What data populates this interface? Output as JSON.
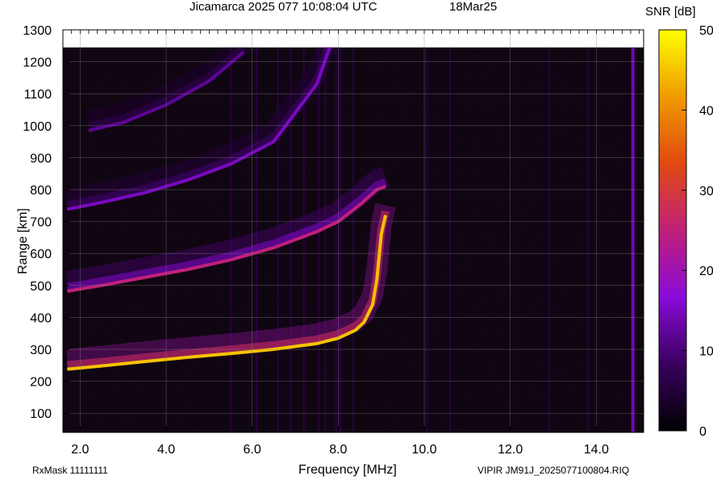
{
  "header": {
    "station_title": "Jicamarca 2025 077 10:08:04 UTC",
    "date_label": "18Mar25",
    "colorbar_title": "SNR [dB]"
  },
  "footer": {
    "rxmask": "RxMask 11111111",
    "file_label": "VIPIR  JM91J_2025077100804.RIQ"
  },
  "chart_data": {
    "type": "heatmap",
    "title": "Jicamarca 2025 077 10:08:04 UTC",
    "xlabel": "Frequency [MHz]",
    "ylabel": "Range [km]",
    "xlim": [
      1.6,
      15.1
    ],
    "ylim": [
      40,
      1300
    ],
    "data_top_range": 1245,
    "x_ticks": [
      "2.0",
      "4.0",
      "6.0",
      "8.0",
      "10.0",
      "12.0",
      "14.0"
    ],
    "x_tick_values": [
      2,
      4,
      6,
      8,
      10,
      12,
      14
    ],
    "y_ticks": [
      "100",
      "200",
      "300",
      "400",
      "500",
      "600",
      "700",
      "800",
      "900",
      "1000",
      "1100",
      "1200",
      "1300"
    ],
    "y_tick_values": [
      100,
      200,
      300,
      400,
      500,
      600,
      700,
      800,
      900,
      1000,
      1100,
      1200,
      1300
    ],
    "grid": true,
    "colorbar": {
      "label": "SNR [dB]",
      "range": [
        0,
        50
      ],
      "ticks": [
        "0",
        "10",
        "20",
        "30",
        "40",
        "50"
      ],
      "tick_values": [
        0,
        10,
        20,
        30,
        40,
        50
      ],
      "colormap": [
        "#000000",
        "#3a0060",
        "#8a0bd8",
        "#c0207a",
        "#e04a10",
        "#f09a00",
        "#ffff00"
      ]
    },
    "traces": [
      {
        "name": "first-hop",
        "points": [
          [
            1.7,
            238
          ],
          [
            2.5,
            248
          ],
          [
            3.5,
            262
          ],
          [
            4.5,
            275
          ],
          [
            5.5,
            287
          ],
          [
            6.5,
            300
          ],
          [
            7.5,
            318
          ],
          [
            8.0,
            335
          ],
          [
            8.4,
            360
          ],
          [
            8.6,
            385
          ],
          [
            8.8,
            440
          ],
          [
            8.9,
            520
          ],
          [
            9.0,
            660
          ],
          [
            9.1,
            720
          ]
        ],
        "peak_snr": 45
      },
      {
        "name": "second-hop",
        "points": [
          [
            1.7,
            482
          ],
          [
            2.5,
            500
          ],
          [
            3.5,
            525
          ],
          [
            4.5,
            550
          ],
          [
            5.5,
            580
          ],
          [
            6.5,
            618
          ],
          [
            7.5,
            668
          ],
          [
            8.0,
            700
          ],
          [
            8.5,
            752
          ],
          [
            8.9,
            800
          ],
          [
            9.1,
            810
          ]
        ],
        "peak_snr": 25
      },
      {
        "name": "third-hop",
        "points": [
          [
            1.7,
            738
          ],
          [
            2.5,
            760
          ],
          [
            3.5,
            790
          ],
          [
            4.5,
            830
          ],
          [
            5.5,
            880
          ],
          [
            6.5,
            950
          ],
          [
            7.0,
            1040
          ],
          [
            7.5,
            1130
          ],
          [
            7.8,
            1245
          ]
        ],
        "peak_snr": 15
      },
      {
        "name": "fourth-hop",
        "points": [
          [
            2.2,
            985
          ],
          [
            3.0,
            1010
          ],
          [
            4.0,
            1065
          ],
          [
            5.0,
            1140
          ],
          [
            5.8,
            1230
          ]
        ],
        "peak_snr": 12
      }
    ],
    "interference_stripes_mhz": [
      5.5,
      6.1,
      6.6,
      6.9,
      7.2,
      7.55,
      7.7,
      7.95,
      8.05,
      8.35,
      10.05,
      10.6,
      12.9,
      13.8
    ],
    "edge_band_mhz": 14.85
  }
}
